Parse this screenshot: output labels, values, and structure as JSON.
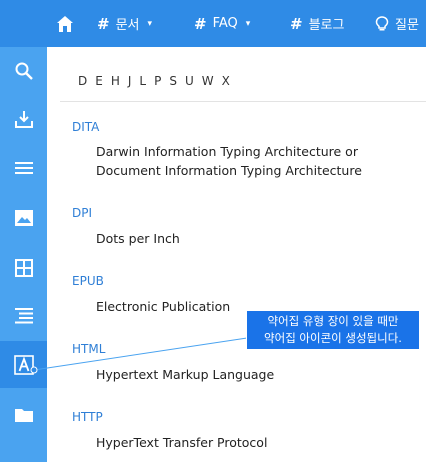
{
  "topnav": {
    "items": [
      {
        "label": "문서",
        "hash": "#",
        "caret": "▾"
      },
      {
        "label": "FAQ",
        "hash": "#",
        "caret": "▾"
      },
      {
        "label": "블로그",
        "hash": "#"
      },
      {
        "label": "질문"
      }
    ]
  },
  "sidebar": {
    "icons": [
      "search-icon",
      "download-icon",
      "menu-icon",
      "image-icon",
      "grid-icon",
      "align-icon",
      "glossary-icon",
      "folder-icon"
    ],
    "active": "glossary-icon"
  },
  "letter_index": [
    "D",
    "E",
    "H",
    "J",
    "L",
    "P",
    "S",
    "U",
    "W",
    "X"
  ],
  "glossary": [
    {
      "term": "DITA",
      "definition": "Darwin Information Typing Architecture or Document Information Typing Architecture"
    },
    {
      "term": "DPI",
      "definition": "Dots per Inch"
    },
    {
      "term": "EPUB",
      "definition": "Electronic Publication"
    },
    {
      "term": "HTML",
      "definition": "Hypertext Markup Language"
    },
    {
      "term": "HTTP",
      "definition": "HyperText Transfer Protocol"
    }
  ],
  "callout": {
    "line1": "약어집 유형 장이 있을 때만",
    "line2": "약어집 아이콘이 생성됩니다."
  },
  "colors": {
    "topbar": "#2f8be6",
    "sidebar": "#4aa3f0",
    "term": "#2f7fd6",
    "callout": "#1a73e8"
  }
}
